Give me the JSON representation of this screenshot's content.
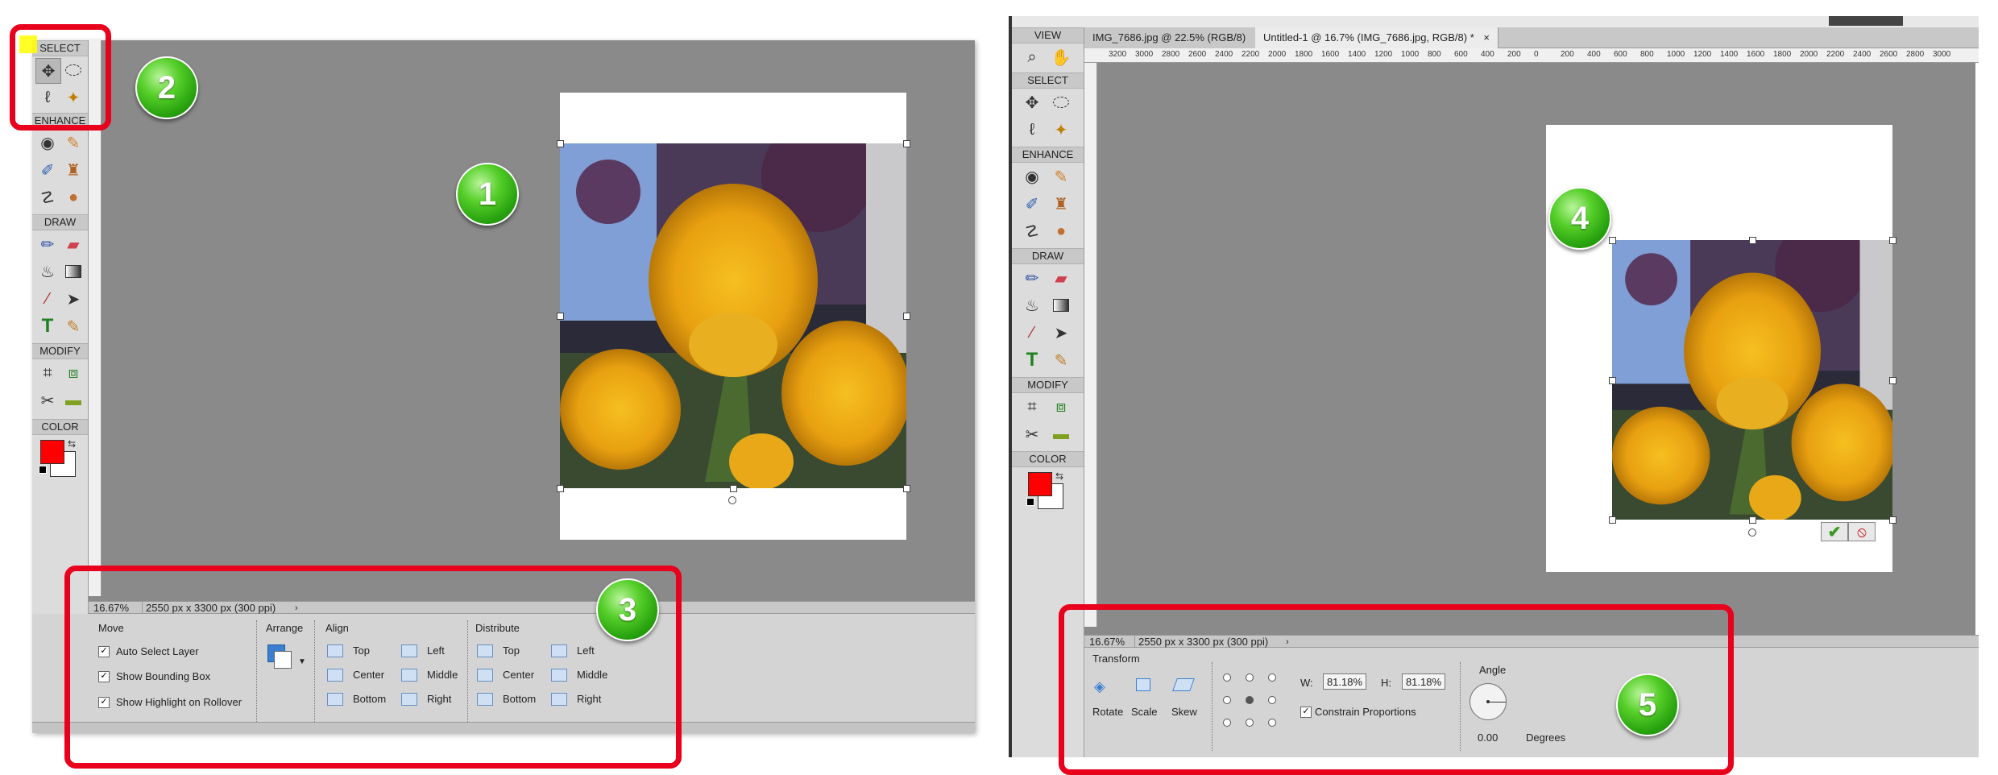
{
  "left": {
    "toolbox": {
      "sections": [
        "SELECT",
        "ENHANCE",
        "DRAW",
        "MODIFY",
        "COLOR"
      ]
    },
    "status": {
      "zoom": "16.67%",
      "doc_info": "2550 px x 3300 px (300 ppi)"
    },
    "options": {
      "move_title": "Move",
      "auto_select": "Auto Select Layer",
      "show_bounding": "Show Bounding Box",
      "show_highlight": "Show Highlight on Rollover",
      "arrange_title": "Arrange",
      "align_title": "Align",
      "align_top": "Top",
      "align_center": "Center",
      "align_bottom": "Bottom",
      "align_left": "Left",
      "align_middle": "Middle",
      "align_right": "Right",
      "distribute_title": "Distribute",
      "dist_top": "Top",
      "dist_center": "Center",
      "dist_bottom": "Bottom",
      "dist_left": "Left",
      "dist_middle": "Middle",
      "dist_right": "Right"
    }
  },
  "right": {
    "toolbox": {
      "sections": [
        "VIEW",
        "SELECT",
        "ENHANCE",
        "DRAW",
        "MODIFY",
        "COLOR"
      ]
    },
    "tabs": [
      "IMG_7686.jpg @ 22.5% (RGB/8)",
      "Untitled-1 @ 16.7% (IMG_7686.jpg, RGB/8) *"
    ],
    "ruler_ticks": [
      "3200",
      "3000",
      "2800",
      "2600",
      "2400",
      "2200",
      "2000",
      "1800",
      "1600",
      "1400",
      "1200",
      "1000",
      "800",
      "600",
      "400",
      "200",
      "0",
      "200",
      "400",
      "600",
      "800",
      "1000",
      "1200",
      "1400",
      "1600",
      "1800",
      "2000",
      "2200",
      "2400",
      "2600",
      "2800",
      "3000"
    ],
    "status": {
      "zoom": "16.67%",
      "doc_info": "2550 px x 3300 px (300 ppi)"
    },
    "options": {
      "transform_title": "Transform",
      "rotate": "Rotate",
      "scale": "Scale",
      "skew": "Skew",
      "w_label": "W:",
      "w_value": "81.18%",
      "h_label": "H:",
      "h_value": "81.18%",
      "constrain": "Constrain Proportions",
      "angle_title": "Angle",
      "angle_value": "0.00",
      "degrees": "Degrees"
    }
  },
  "badges": [
    "1",
    "2",
    "3",
    "4",
    "5"
  ],
  "colors": {
    "callout": "#e8001c",
    "foreground": "#ff0000",
    "background": "#ffffff",
    "canvas": "#8a8a8a"
  }
}
